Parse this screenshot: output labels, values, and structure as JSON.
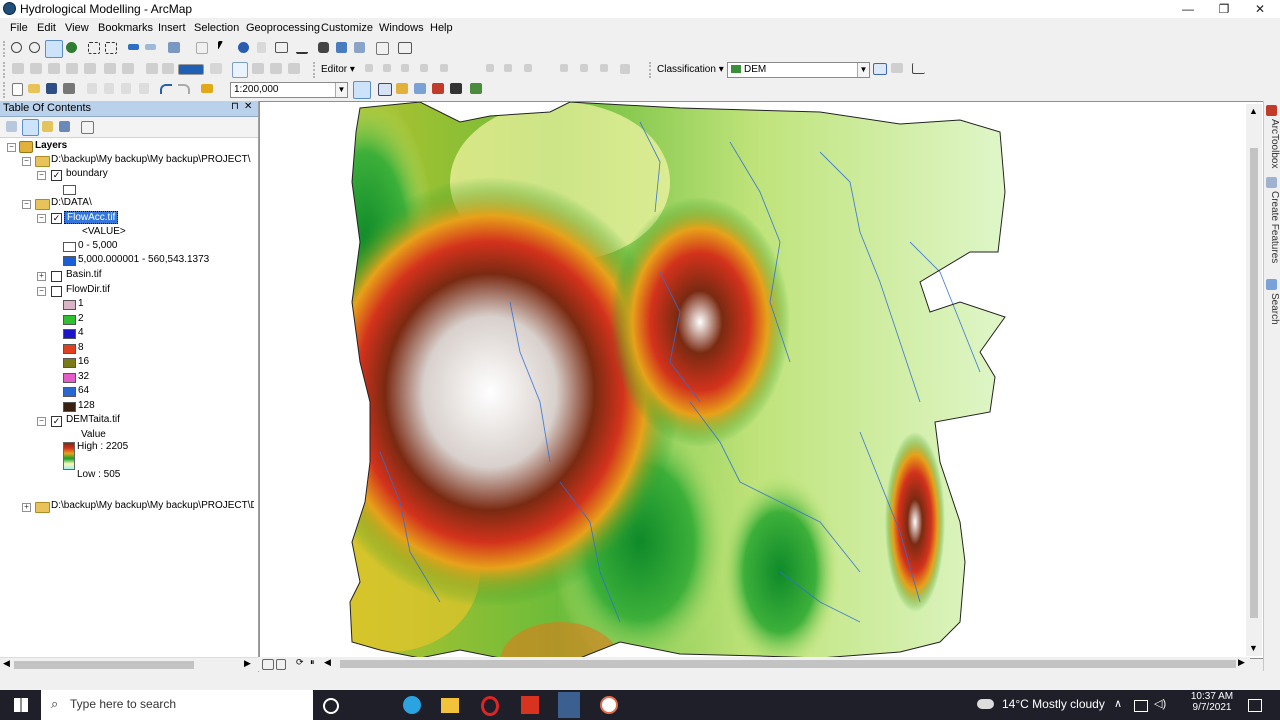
{
  "window": {
    "title": "Hydrological Modelling - ArcMap",
    "controls": {
      "minimize": "—",
      "maximize": "❐",
      "close": "✕"
    }
  },
  "menu": [
    "File",
    "Edit",
    "View",
    "Bookmarks",
    "Insert",
    "Selection",
    "Geoprocessing",
    "Customize",
    "Windows",
    "Help"
  ],
  "toolbars": {
    "editor_label": "Editor ▾",
    "classification_label": "Classification ▾",
    "layer_combo": "DEM",
    "scale_combo": "1:200,000"
  },
  "toc": {
    "title": "Table Of Contents",
    "header_buttons": {
      "pin": "⊓",
      "close": "✕"
    },
    "root": "Layers",
    "group1": "D:\\backup\\My backup\\My backup\\PROJECT\\DA",
    "boundary": "boundary",
    "group2": "D:\\DATA\\",
    "flowacc": {
      "name": "FlowAcc.tif",
      "field": "<VALUE>",
      "classes": [
        {
          "label": "0 - 5,000",
          "color": "#ffffff"
        },
        {
          "label": "5,000.000001 - 560,543.1373",
          "color": "#1a5fd6"
        }
      ]
    },
    "basin": "Basin.tif",
    "flowdir": {
      "name": "FlowDir.tif",
      "classes": [
        {
          "label": "1",
          "color": "#d8b4c4"
        },
        {
          "label": "2",
          "color": "#2fbf2f"
        },
        {
          "label": "4",
          "color": "#1c14c8"
        },
        {
          "label": "8",
          "color": "#e04020"
        },
        {
          "label": "16",
          "color": "#7a7a18"
        },
        {
          "label": "32",
          "color": "#e45cc8"
        },
        {
          "label": "64",
          "color": "#2868d0"
        },
        {
          "label": "128",
          "color": "#3b1f10"
        }
      ]
    },
    "dem": {
      "name": "DEMTaita.tif",
      "field": "Value",
      "high": "High : 2205",
      "low": "Low : 505"
    },
    "group3": "D:\\backup\\My backup\\My backup\\PROJECT\\DA"
  },
  "right_dock": [
    "ArcToolbox",
    "Create Features",
    "Search"
  ],
  "taskbar": {
    "search_placeholder": "Type here to search",
    "weather": "14°C  Mostly cloudy",
    "time": "10:37 AM",
    "date": "9/7/2021"
  },
  "colors": {
    "toc_header": "#b9d1ea",
    "taskbar": "#1f1f2a",
    "dem_ramp": [
      "#a6f0ef",
      "#f7f9b3",
      "#16a02a",
      "#e7a21a",
      "#d3321c",
      "#7a2a12",
      "#ffffff"
    ]
  }
}
